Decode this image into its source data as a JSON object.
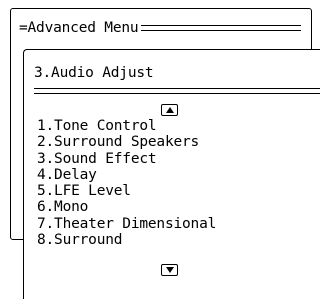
{
  "outer_menu": {
    "title": "=Advanced Menu"
  },
  "inner_menu": {
    "title": "3.Audio Adjust",
    "scroll_up_icon": "up-arrow-icon",
    "scroll_down_icon": "down-arrow-icon",
    "items": [
      {
        "label": "1.Tone Control"
      },
      {
        "label": "2.Surround Speakers"
      },
      {
        "label": "3.Sound Effect"
      },
      {
        "label": "4.Delay"
      },
      {
        "label": "5.LFE Level"
      },
      {
        "label": "6.Mono"
      },
      {
        "label": "7.Theater Dimensional"
      },
      {
        "label": "8.Surround"
      }
    ]
  }
}
